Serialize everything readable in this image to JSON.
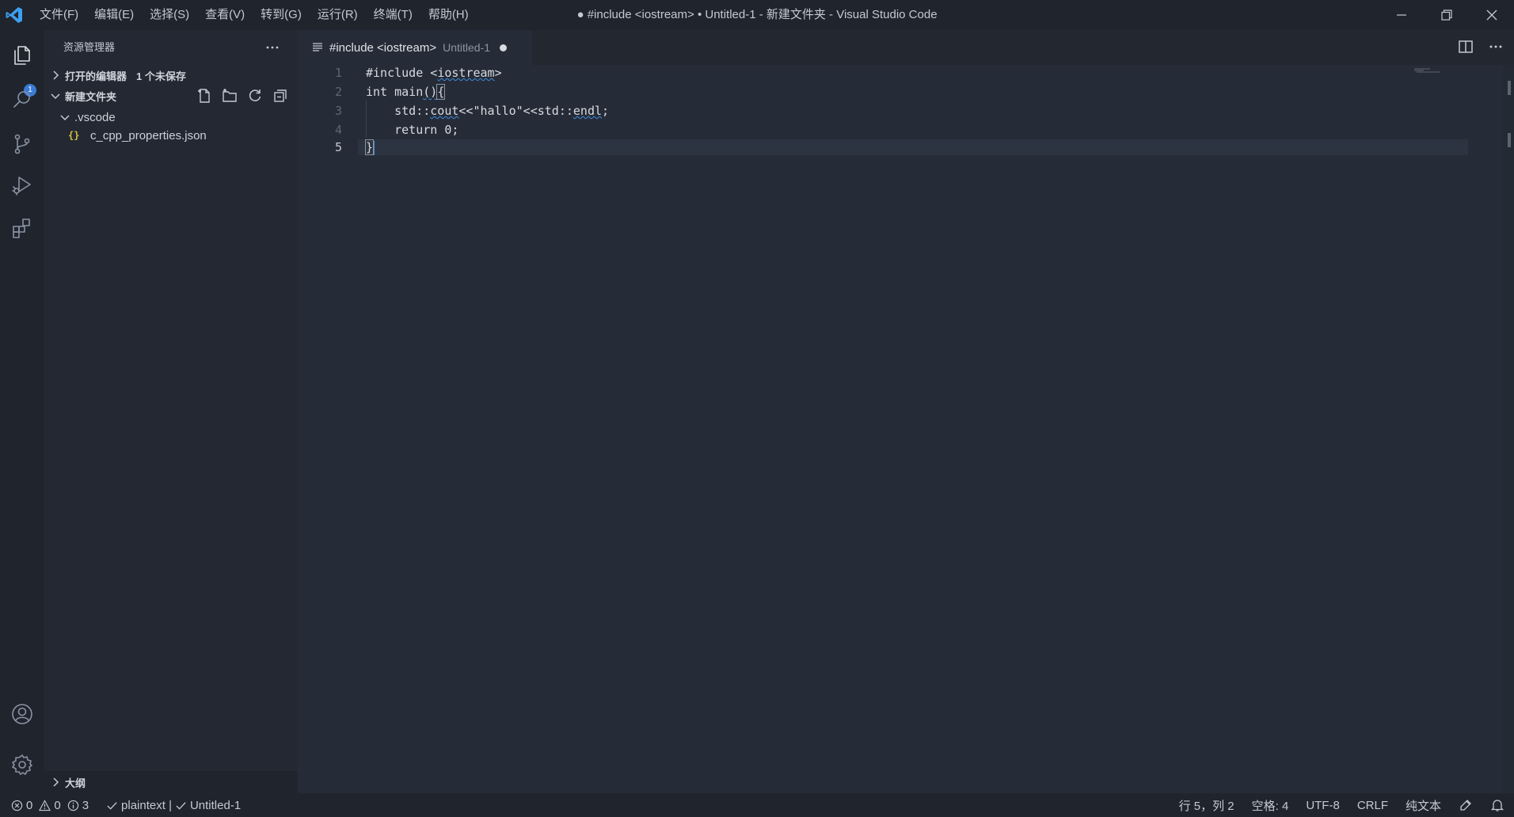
{
  "titlebar": {
    "menu": [
      "文件(F)",
      "编辑(E)",
      "选择(S)",
      "查看(V)",
      "转到(G)",
      "运行(R)",
      "终端(T)",
      "帮助(H)"
    ],
    "window_title": "● #include <iostream> • Untitled-1 - 新建文件夹 - Visual Studio Code"
  },
  "activitybar": {
    "explorer_badge": "1",
    "icons": [
      "explorer-icon",
      "search-icon",
      "source-control-icon",
      "run-debug-icon",
      "extensions-icon",
      "account-icon",
      "settings-gear-icon"
    ]
  },
  "sidebar": {
    "title": "资源管理器",
    "open_editors_label": "打开的编辑器",
    "open_editors_badge": "1 个未保存",
    "folder_label": "新建文件夹",
    "tree": [
      {
        "label": ".vscode",
        "type": "folder",
        "expanded": true
      },
      {
        "label": "c_cpp_properties.json",
        "type": "json-file"
      }
    ],
    "outline_label": "大纲"
  },
  "tab": {
    "label": "#include <iostream>",
    "description": "Untitled-1"
  },
  "editor": {
    "line_numbers": [
      "1",
      "2",
      "3",
      "4",
      "5"
    ],
    "active_line": 5,
    "lines": [
      "#include <iostream>",
      "int main(){",
      "    std::cout<<\"hallo\"<<std::endl;",
      "    return 0;",
      "}"
    ]
  },
  "statusbar": {
    "errors": "0",
    "warnings": "0",
    "infos": "3",
    "language_check": "plaintext | ",
    "file_check": "Untitled-1",
    "cursor_pos": "行 5，列 2",
    "indent": "空格: 4",
    "encoding": "UTF-8",
    "eol": "CRLF",
    "language": "纯文本"
  },
  "colors": {
    "background": "#262c37",
    "chrome": "#1f242d",
    "sidebar": "#232833",
    "accent": "#3a7bd5"
  }
}
